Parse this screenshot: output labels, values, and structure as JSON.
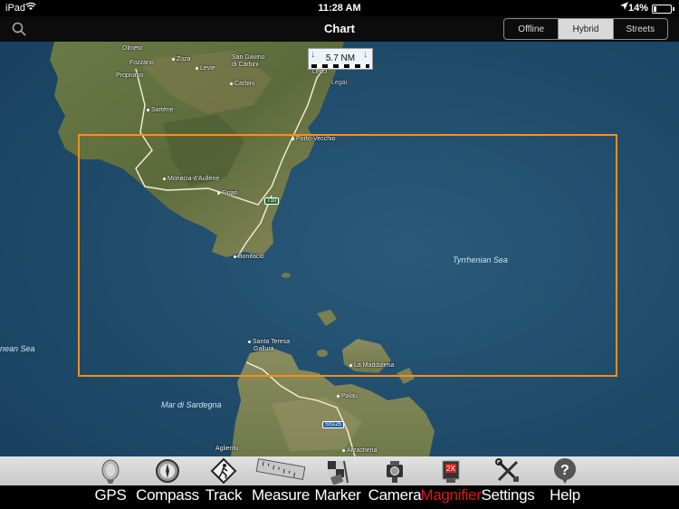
{
  "status_bar": {
    "device": "iPad",
    "time": "11:28 AM",
    "battery_pct": "14%",
    "battery_level": 0.14,
    "icons": [
      "wifi-icon",
      "location-arrow-icon",
      "battery-icon"
    ]
  },
  "nav": {
    "title": "Chart",
    "search_icon": "search-icon",
    "segments": [
      {
        "label": "Offline",
        "active": false
      },
      {
        "label": "Hybrid",
        "active": true
      },
      {
        "label": "Streets",
        "active": false
      }
    ]
  },
  "map": {
    "scale_label": "5.7 NM",
    "labels": {
      "olmeto": "Olmeto",
      "fozzano": "Fozzano",
      "propriano": "Propriano",
      "zoza": "Zoza",
      "levie": "Levie",
      "san_gavino": "San Gavino",
      "di_carbini": "di Carbini",
      "carbini": "Carbini",
      "sartene": "Sartène",
      "lecci": "Lecci",
      "legal": "Legal",
      "porto_vecchio": "Porto-Vecchio",
      "monacia": "Monacia-d'Aullène",
      "figari": "Figari",
      "bonifacio": "Bonifacio",
      "santa_teresa": "Santa Teresa",
      "gallura": "Gallura",
      "la_maddalena": "La Maddalena",
      "palau": "Palau",
      "aglientu": "Aglientu",
      "arzachena": "Arzachena",
      "tyrrhenian_sea": "Tyrrhenian Sea",
      "mar_di_sardegna": "Mar di Sardegna",
      "nean_sea": "nean Sea",
      "road_t10": "T10",
      "road_ss125": "SS125"
    },
    "frame_color": "#ff8c1a"
  },
  "toolbar": {
    "items": [
      {
        "label": "GPS",
        "icon": "satellite-dish-icon",
        "active": false
      },
      {
        "label": "Compass",
        "icon": "compass-icon",
        "active": false
      },
      {
        "label": "Track",
        "icon": "track-sign-icon",
        "active": false
      },
      {
        "label": "Measure",
        "icon": "ruler-icon",
        "active": false
      },
      {
        "label": "Marker",
        "icon": "marker-flag-icon",
        "active": false
      },
      {
        "label": "Camera",
        "icon": "camera-icon",
        "active": false
      },
      {
        "label": "Magnifier",
        "icon": "magnifier-2x-icon",
        "active": true
      },
      {
        "label": "Settings",
        "icon": "wrench-screwdriver-icon",
        "active": false
      },
      {
        "label": "Help",
        "icon": "help-bubble-icon",
        "active": false
      }
    ],
    "active_color": "#e0141b"
  }
}
